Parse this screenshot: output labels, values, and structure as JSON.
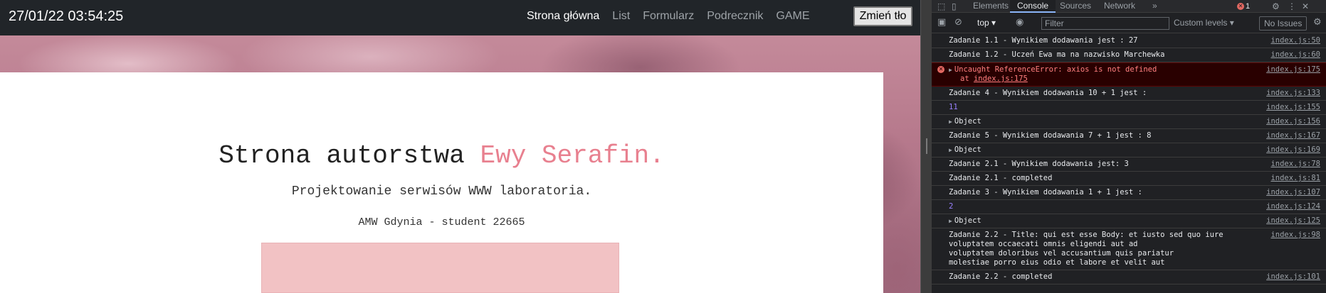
{
  "site": {
    "clock": "27/01/22 03:54:25",
    "nav": [
      {
        "label": "Strona główna",
        "active": true
      },
      {
        "label": "List",
        "active": false
      },
      {
        "label": "Formularz",
        "active": false
      },
      {
        "label": "Podrecznik",
        "active": false
      },
      {
        "label": "GAME",
        "active": false
      }
    ],
    "bg_button": "Zmień tło",
    "title_main": "Strona autorstwa ",
    "title_highlight": "Ewy Serafin.",
    "subtitle": "Projektowanie serwisów WWW laboratoria.",
    "author": "AMW Gdynia - student 22665",
    "accent_color": "#e8808f"
  },
  "devtools": {
    "tabs": [
      "Elements",
      "Console",
      "Sources",
      "Network"
    ],
    "active_tab": "Console",
    "more_tabs": "»",
    "error_count": "1",
    "context": "top ▾",
    "filter_placeholder": "Filter",
    "levels": "Custom levels ▾",
    "issues": "No Issues",
    "messages": [
      {
        "type": "log",
        "text": "Zadanie 1.1 - Wynikiem dodawania jest : 27",
        "src": "index.js:50"
      },
      {
        "type": "log",
        "text": "Zadanie 1.2 - Uczeń Ewa ma na nazwisko Marchewka",
        "src": "index.js:60"
      },
      {
        "type": "error",
        "text": "Uncaught ReferenceError: axios is not defined",
        "stack_prefix": "at ",
        "stack_link": "index.js:175",
        "src": "index.js:175"
      },
      {
        "type": "log",
        "text": "Zadanie 4 - Wynikiem dodawania 10 + 1 jest :",
        "src": "index.js:133"
      },
      {
        "type": "num",
        "text": "11",
        "src": "index.js:155"
      },
      {
        "type": "obj",
        "text": "Object",
        "src": "index.js:156"
      },
      {
        "type": "log",
        "text": "Zadanie 5 - Wynikiem dodawania 7 + 1 jest : 8",
        "src": "index.js:167"
      },
      {
        "type": "obj",
        "text": "Object",
        "src": "index.js:169"
      },
      {
        "type": "log",
        "text": "Zadanie 2.1 - Wynikiem dodawania jest: 3",
        "src": "index.js:78"
      },
      {
        "type": "log",
        "text": "Zadanie 2.1 - completed",
        "src": "index.js:81"
      },
      {
        "type": "log",
        "text": "Zadanie 3 - Wynikiem dodawania 1 + 1 jest :",
        "src": "index.js:107"
      },
      {
        "type": "num",
        "text": "2",
        "src": "index.js:124"
      },
      {
        "type": "obj",
        "text": "Object",
        "src": "index.js:125"
      },
      {
        "type": "log",
        "text": "Zadanie 2.2 - Title: qui est esse Body: et iusto sed quo iure\nvoluptatem occaecati omnis eligendi aut ad\nvoluptatem doloribus vel accusantium quis pariatur\nmolestiae porro eius odio et labore et velit aut",
        "src": "index.js:98"
      },
      {
        "type": "log",
        "text": "Zadanie 2.2 - completed",
        "src": "index.js:101"
      }
    ]
  }
}
